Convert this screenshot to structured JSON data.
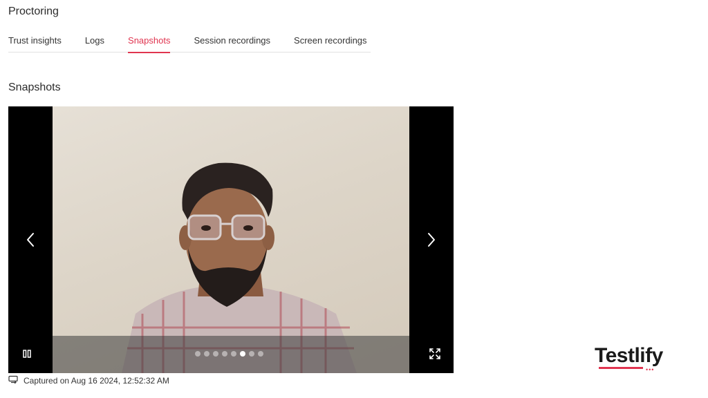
{
  "header": {
    "title": "Proctoring"
  },
  "tabs": [
    {
      "label": "Trust insights",
      "active": false
    },
    {
      "label": "Logs",
      "active": false
    },
    {
      "label": "Snapshots",
      "active": true
    },
    {
      "label": "Session recordings",
      "active": false
    },
    {
      "label": "Screen recordings",
      "active": false
    }
  ],
  "section": {
    "title": "Snapshots"
  },
  "viewer": {
    "prev_icon": "chevron-left-icon",
    "next_icon": "chevron-right-icon",
    "pause_icon": "pause-icon",
    "fullscreen_icon": "expand-icon",
    "dot_count": 8,
    "active_dot_index": 5
  },
  "caption": {
    "icon": "camera-capture-icon",
    "text": "Captured on Aug 16 2024, 12:52:32 AM"
  },
  "brand": {
    "name": "Testlify"
  },
  "colors": {
    "accent": "#e0344f",
    "viewer_bg": "#000000"
  }
}
